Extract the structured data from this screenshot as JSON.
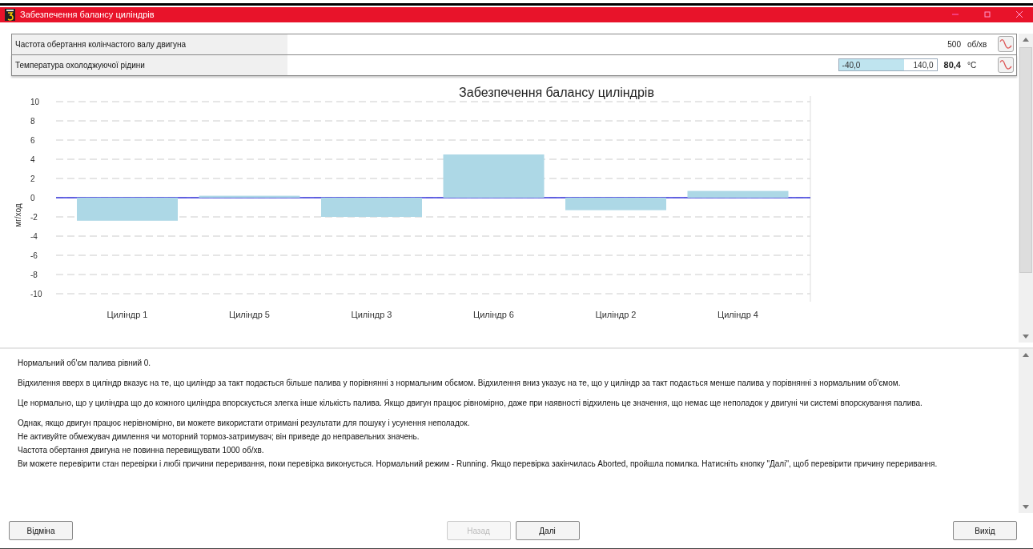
{
  "window": {
    "title": "Забезпечення балансу циліндрів"
  },
  "parameters": [
    {
      "kind": "value",
      "label": "Частота обертання колінчастого валу двигуна",
      "value": "500",
      "unit": "об/хв"
    },
    {
      "kind": "range",
      "label": "Температура охолоджуючої рідини",
      "min": "-40,0",
      "max": "140,0",
      "level": 0.67,
      "value": "80,4",
      "unit": "°C"
    }
  ],
  "chart": {
    "chart_data": {
      "type": "bar",
      "title": "Забезпечення балансу циліндрів",
      "ylabel": "мг/ход",
      "categories": [
        "Циліндр 1",
        "Циліндр 5",
        "Циліндр 3",
        "Циліндр 6",
        "Циліндр 2",
        "Циліндр 4"
      ],
      "series": [
        {
          "color": "#add8e6",
          "values": [
            -2.4,
            0.2,
            -2.0,
            4.5,
            -1.3,
            0.7
          ]
        }
      ],
      "ylim": [
        -10,
        10
      ],
      "yticks": [
        10,
        8,
        6,
        4,
        2,
        0,
        -2,
        -4,
        -6,
        -8,
        -10
      ],
      "grid": true,
      "ref_lines": [
        {
          "axis": "y",
          "value": 0,
          "color": "#3333dd"
        }
      ]
    }
  },
  "info": [
    "Нормальний об'єм палива рівний 0.",
    "Відхилення вверх  в циліндр вказує на те, що циліндр за такт подається більше палива у порівнянні з нормальним обємом. Відхилення вниз указує на те, що у циліндр за такт подається менше палива у порівнянні з нормальним об'ємом.",
    "Це нормально, що у циліндра що до кожного циліндра впорскується злегка інше кількість палива. Якщо двигун працює рівномірно, даже при наявності відхилень це значення, що немає ще неполадок у двигуні чи системі впорскування палива.",
    "Однак, якщо двигун працює нерівномірно, ви можете використати отримані результати для пошуку і усунення неполадок.",
    "Не активуйте обмежувач димлення чи моторний тормоз-затримувач; він приведе до неправельних значень.",
    "Частота обертання двигуна не повинна перевищувати 1000 об/хв.",
    "Ви можете перевірити стан  перевірки і любі причини переривання, поки перевірка виконується. Нормальний режим - Running. Якщо перевірка закінчилась Aborted, пройшла помилка. Натисніть кнопку \"Далі\",  щоб перевірити причину переривання."
  ],
  "buttons": [
    {
      "kind": "left",
      "label": "Відміна",
      "disabled": false
    },
    {
      "kind": "center",
      "label": "Назад",
      "disabled": true
    },
    {
      "kind": "center",
      "label": "Далі",
      "disabled": false
    },
    {
      "kind": "right",
      "label": "Вихід",
      "disabled": false
    }
  ]
}
